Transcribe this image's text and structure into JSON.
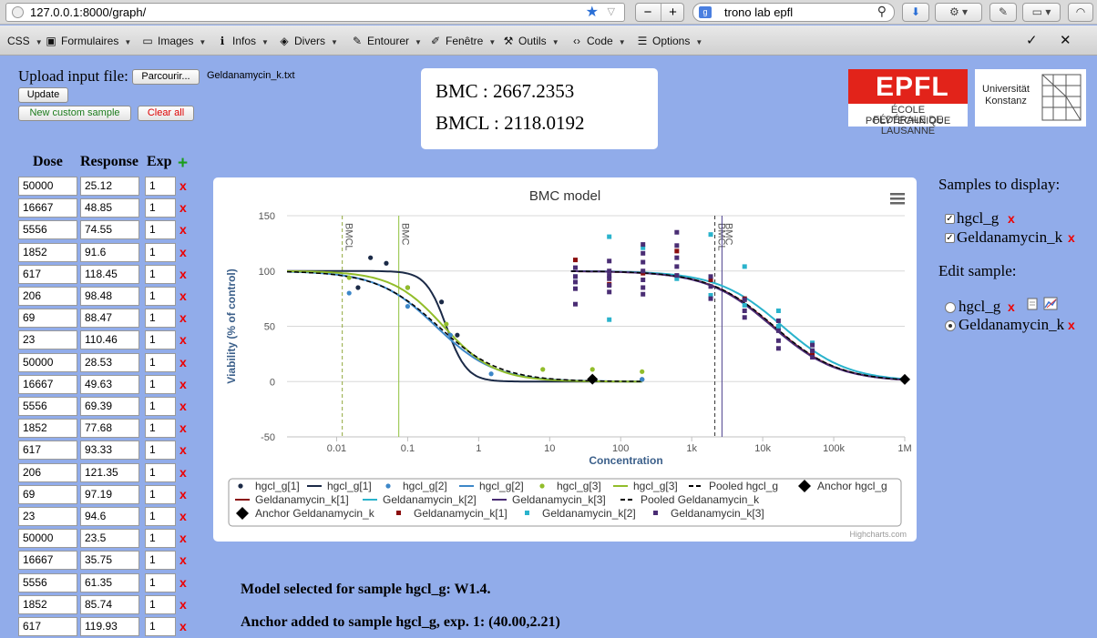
{
  "browser": {
    "url": "127.0.0.1:8000/graph/",
    "search_text": "trono lab epfl",
    "toolbar": [
      {
        "label": "CSS",
        "icon": "css-icon"
      },
      {
        "label": "Formulaires",
        "icon": "form-icon"
      },
      {
        "label": "Images",
        "icon": "image-icon"
      },
      {
        "label": "Infos",
        "icon": "info-icon"
      },
      {
        "label": "Divers",
        "icon": "cube-icon"
      },
      {
        "label": "Entourer",
        "icon": "outline-icon"
      },
      {
        "label": "Fenêtre",
        "icon": "pencil-icon"
      },
      {
        "label": "Outils",
        "icon": "wrench-icon"
      },
      {
        "label": "Code",
        "icon": "code-icon"
      },
      {
        "label": "Options",
        "icon": "options-icon"
      }
    ]
  },
  "upload": {
    "label": "Upload input file:",
    "browse_button": "Parcourir...",
    "filename": "Geldanamycin_k.txt",
    "update_button": "Update",
    "new_sample_button": "New custom sample",
    "clear_button": "Clear all"
  },
  "results": {
    "bmc": "BMC : 2667.2353",
    "bmcl": "BMCL : 2118.0192"
  },
  "logos": {
    "epfl_mark": "EPFL",
    "epfl_line1": "ÉCOLE POLYTECHNIQUE",
    "epfl_line2": "FÉDÉRALE DE LAUSANNE",
    "uk_line1": "Universität",
    "uk_line2": "Konstanz"
  },
  "table": {
    "headers": [
      "Dose",
      "Response",
      "Exp"
    ],
    "rows": [
      [
        "50000",
        "25.12",
        "1"
      ],
      [
        "16667",
        "48.85",
        "1"
      ],
      [
        "5556",
        "74.55",
        "1"
      ],
      [
        "1852",
        "91.6",
        "1"
      ],
      [
        "617",
        "118.45",
        "1"
      ],
      [
        "206",
        "98.48",
        "1"
      ],
      [
        "69",
        "88.47",
        "1"
      ],
      [
        "23",
        "110.46",
        "1"
      ],
      [
        "50000",
        "28.53",
        "1"
      ],
      [
        "16667",
        "49.63",
        "1"
      ],
      [
        "5556",
        "69.39",
        "1"
      ],
      [
        "1852",
        "77.68",
        "1"
      ],
      [
        "617",
        "93.33",
        "1"
      ],
      [
        "206",
        "121.35",
        "1"
      ],
      [
        "69",
        "97.19",
        "1"
      ],
      [
        "23",
        "94.6",
        "1"
      ],
      [
        "50000",
        "23.5",
        "1"
      ],
      [
        "16667",
        "35.75",
        "1"
      ],
      [
        "5556",
        "61.35",
        "1"
      ],
      [
        "1852",
        "85.74",
        "1"
      ],
      [
        "617",
        "119.93",
        "1"
      ]
    ],
    "delete_glyph": "x",
    "add_glyph": "+"
  },
  "chart_data": {
    "type": "scatter",
    "title": "BMC model",
    "xlabel": "Concentration",
    "ylabel": "Viability (% of control)",
    "xscale": "log",
    "xlim": [
      0.002,
      1000000
    ],
    "ylim": [
      -50,
      150
    ],
    "x_ticks": [
      "0.01",
      "0.1",
      "1",
      "10",
      "100",
      "1k",
      "10k",
      "100k",
      "1M"
    ],
    "x_tick_values": [
      0.01,
      0.1,
      1,
      10,
      100,
      1000,
      10000,
      100000,
      1000000
    ],
    "y_ticks": [
      -50,
      0,
      50,
      100,
      150
    ],
    "vlines": [
      {
        "label": "BMCL",
        "x": 0.012,
        "color": "#8fa83a",
        "dash": true
      },
      {
        "label": "BMC",
        "x": 0.075,
        "color": "#8fc03a",
        "dash": false
      },
      {
        "label": "BMCL",
        "x": 2118,
        "color": "#333333",
        "dash": true
      },
      {
        "label": "BMC",
        "x": 2667,
        "color": "#4b3f8c",
        "dash": false
      }
    ],
    "curves": [
      {
        "name": "hgcl_g[1]",
        "color": "#1b2a47",
        "top": 100,
        "bottom": 0,
        "ec50": 0.35,
        "slope": 3.0,
        "xmax": 200
      },
      {
        "name": "hgcl_g[2]",
        "color": "#3d87c8",
        "top": 100,
        "bottom": 0,
        "ec50": 0.25,
        "slope": 1.05,
        "xmax": 200
      },
      {
        "name": "hgcl_g[3]",
        "color": "#92bd2a",
        "top": 100,
        "bottom": 0,
        "ec50": 0.32,
        "slope": 1.2,
        "xmax": 200
      },
      {
        "name": "Pooled hgcl_g",
        "color": "#000000",
        "dash": true,
        "top": 100,
        "bottom": 0,
        "ec50": 0.27,
        "slope": 1.0,
        "xmax": 200
      },
      {
        "name": "Geldanamycin_k[1]",
        "color": "#8b0e0e",
        "top": 100,
        "bottom": 0,
        "ec50": 14000,
        "slope": 0.95,
        "xmin": 20
      },
      {
        "name": "Geldanamycin_k[2]",
        "color": "#2ab3cc",
        "top": 100,
        "bottom": 0,
        "ec50": 19000,
        "slope": 0.95,
        "xmin": 20
      },
      {
        "name": "Geldanamycin_k[3]",
        "color": "#4a2d74",
        "top": 100,
        "bottom": 0,
        "ec50": 13500,
        "slope": 0.95,
        "xmin": 20
      },
      {
        "name": "Pooled Geldanamycin_k",
        "color": "#000000",
        "dash": true,
        "top": 100,
        "bottom": 0,
        "ec50": 14500,
        "slope": 0.95,
        "xmin": 20
      }
    ],
    "series_points": [
      {
        "name": "hgcl_g[1]",
        "color": "#1b2a47",
        "shape": "circle",
        "points": [
          [
            0.02,
            85
          ],
          [
            0.03,
            112
          ],
          [
            0.05,
            107
          ],
          [
            0.1,
            85
          ],
          [
            0.3,
            72
          ],
          [
            0.5,
            42
          ],
          [
            200,
            2
          ]
        ]
      },
      {
        "name": "hgcl_g[2]",
        "color": "#3d87c8",
        "shape": "circle",
        "points": [
          [
            0.015,
            80
          ],
          [
            0.1,
            68
          ],
          [
            0.4,
            42
          ],
          [
            1.5,
            7
          ],
          [
            200,
            2
          ]
        ]
      },
      {
        "name": "hgcl_g[3]",
        "color": "#92bd2a",
        "shape": "circle",
        "points": [
          [
            0.015,
            94
          ],
          [
            0.1,
            85
          ],
          [
            0.35,
            52
          ],
          [
            8,
            11
          ],
          [
            40,
            11
          ],
          [
            200,
            9
          ]
        ]
      },
      {
        "name": "Geldanamycin_k[1]",
        "color": "#8b0e0e",
        "shape": "square",
        "points": [
          [
            23,
            110
          ],
          [
            69,
            88
          ],
          [
            206,
            98
          ],
          [
            617,
            118
          ],
          [
            1852,
            92
          ],
          [
            5556,
            75
          ],
          [
            16667,
            49
          ],
          [
            50000,
            25
          ]
        ]
      },
      {
        "name": "Geldanamycin_k[2]",
        "color": "#2ab3cc",
        "shape": "square",
        "points": [
          [
            23,
            95
          ],
          [
            69,
            131
          ],
          [
            69,
            56
          ],
          [
            206,
            121
          ],
          [
            617,
            93
          ],
          [
            1852,
            133
          ],
          [
            1852,
            78
          ],
          [
            5556,
            104
          ],
          [
            5556,
            69
          ],
          [
            16667,
            64
          ],
          [
            16667,
            50
          ],
          [
            50000,
            35
          ],
          [
            50000,
            28
          ]
        ]
      },
      {
        "name": "Geldanamycin_k[3]",
        "color": "#4a2d74",
        "shape": "square",
        "points": [
          [
            23,
            103
          ],
          [
            23,
            95
          ],
          [
            23,
            90
          ],
          [
            23,
            84
          ],
          [
            23,
            70
          ],
          [
            69,
            109
          ],
          [
            69,
            100
          ],
          [
            69,
            96
          ],
          [
            69,
            93
          ],
          [
            69,
            87
          ],
          [
            69,
            81
          ],
          [
            206,
            124
          ],
          [
            206,
            116
          ],
          [
            206,
            108
          ],
          [
            206,
            100
          ],
          [
            206,
            92
          ],
          [
            206,
            85
          ],
          [
            206,
            79
          ],
          [
            617,
            135
          ],
          [
            617,
            123
          ],
          [
            617,
            112
          ],
          [
            617,
            104
          ],
          [
            617,
            96
          ],
          [
            1852,
            95
          ],
          [
            1852,
            86
          ],
          [
            1852,
            75
          ],
          [
            5556,
            74
          ],
          [
            5556,
            64
          ],
          [
            5556,
            58
          ],
          [
            16667,
            55
          ],
          [
            16667,
            46
          ],
          [
            16667,
            37
          ],
          [
            16667,
            30
          ],
          [
            50000,
            33
          ],
          [
            50000,
            28
          ],
          [
            50000,
            22
          ]
        ]
      }
    ],
    "anchors": [
      {
        "name": "Anchor hgcl_g",
        "x": 40,
        "y": 2.21
      },
      {
        "name": "Anchor Geldanamycin_k",
        "x": 1000000,
        "y": 2
      }
    ],
    "legend": [
      {
        "label": "hgcl_g[1]",
        "kind": "dot",
        "color": "#1b2a47"
      },
      {
        "label": "hgcl_g[1]",
        "kind": "line",
        "color": "#1b2a47"
      },
      {
        "label": "hgcl_g[2]",
        "kind": "dot",
        "color": "#3d87c8"
      },
      {
        "label": "hgcl_g[2]",
        "kind": "line",
        "color": "#3d87c8"
      },
      {
        "label": "hgcl_g[3]",
        "kind": "dot",
        "color": "#92bd2a"
      },
      {
        "label": "hgcl_g[3]",
        "kind": "line",
        "color": "#92bd2a"
      },
      {
        "label": "Pooled hgcl_g",
        "kind": "dash",
        "color": "#000000"
      },
      {
        "label": "Anchor hgcl_g",
        "kind": "diamond",
        "color": "#000000"
      },
      {
        "label": "Geldanamycin_k[1]",
        "kind": "line",
        "color": "#8b0e0e"
      },
      {
        "label": "Geldanamycin_k[2]",
        "kind": "line",
        "color": "#2ab3cc"
      },
      {
        "label": "Geldanamycin_k[3]",
        "kind": "line",
        "color": "#4a2d74"
      },
      {
        "label": "Pooled Geldanamycin_k",
        "kind": "dash",
        "color": "#000000"
      },
      {
        "label": "Anchor Geldanamycin_k",
        "kind": "diamond",
        "color": "#000000"
      },
      {
        "label": "Geldanamycin_k[1]",
        "kind": "square",
        "color": "#8b0e0e"
      },
      {
        "label": "Geldanamycin_k[2]",
        "kind": "square",
        "color": "#2ab3cc"
      },
      {
        "label": "Geldanamycin_k[3]",
        "kind": "square",
        "color": "#4a2d74"
      }
    ],
    "credits": "Highcharts.com"
  },
  "right_panel": {
    "display_title": "Samples to display:",
    "display_samples": [
      "hgcl_g",
      "Geldanamycin_k"
    ],
    "edit_title": "Edit sample:",
    "edit_samples": [
      "hgcl_g",
      "Geldanamycin_k"
    ],
    "edit_selected": "Geldanamycin_k"
  },
  "messages": {
    "model": "Model selected for sample hgcl_g: W1.4.",
    "anchor": "Anchor added to sample hgcl_g, exp. 1: (40.00,2.21)"
  }
}
